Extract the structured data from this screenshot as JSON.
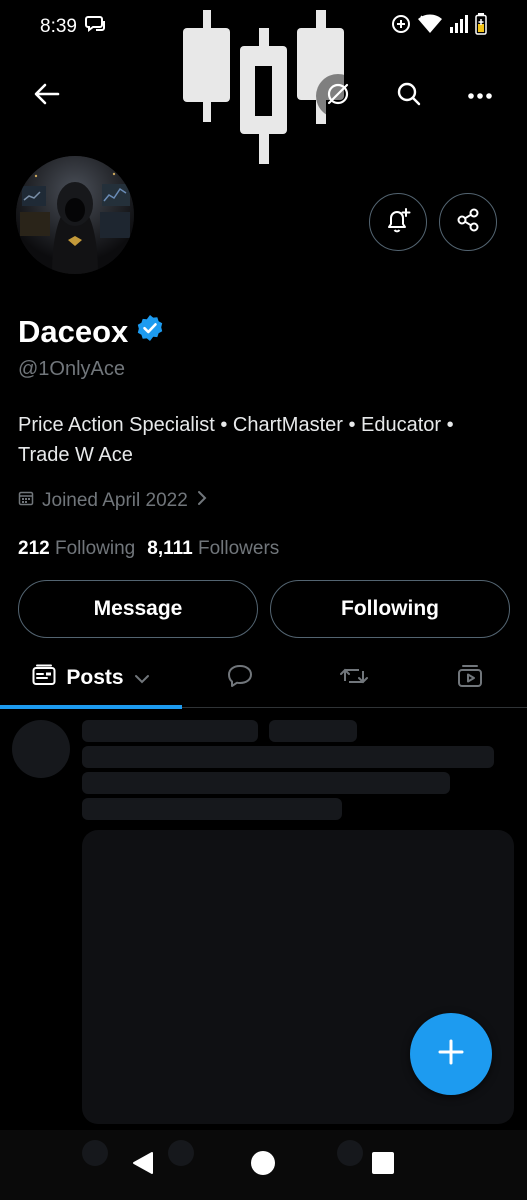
{
  "status_bar": {
    "time": "8:39"
  },
  "icons": {
    "back": "arrow-left-icon",
    "grok": "grok-icon",
    "search": "search-icon",
    "more": "more-dots-icon",
    "notify": "bell-plus-icon",
    "share": "share-icon",
    "verified": "verified-badge-icon",
    "calendar": "calendar-icon",
    "chevron": "chevron-right-icon",
    "posts_tab": "posts-icon",
    "replies_tab": "reply-bubble-icon",
    "reposts_tab": "repost-icon",
    "media_tab": "media-icon",
    "compose": "plus-icon"
  },
  "profile": {
    "name": "Daceox",
    "handle": "@1OnlyAce",
    "bio_line1": "Price Action Specialist  • ChartMaster • Educator •",
    "bio_line2": "Trade W Ace",
    "joined": "Joined April 2022",
    "following_count": "212",
    "following_label": "Following",
    "followers_count": "8,111",
    "followers_label": "Followers"
  },
  "actions": {
    "message_label": "Message",
    "following_label": "Following"
  },
  "tabs": {
    "posts_label": "Posts"
  },
  "colors": {
    "accent": "#1d9bf0",
    "background": "#000000",
    "secondary_text": "#71767b",
    "border": "#536471"
  }
}
